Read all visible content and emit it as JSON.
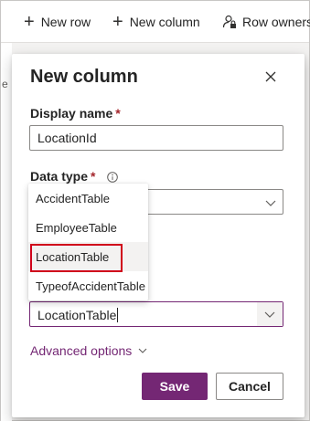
{
  "command_bar": {
    "new_row": "New row",
    "new_column": "New column",
    "row_ownership": "Row ownershi"
  },
  "left_strip": {
    "glyph": "e"
  },
  "panel": {
    "title": "New column",
    "display_name": {
      "label": "Display name",
      "required_mark": "*",
      "value": "LocationId"
    },
    "data_type": {
      "label": "Data type",
      "required_mark": "*"
    },
    "lookup": {
      "value": "LocationTable"
    },
    "advanced_options": "Advanced options",
    "save_label": "Save",
    "cancel_label": "Cancel"
  },
  "dropdown_menu": {
    "items": [
      {
        "label": "AccidentTable"
      },
      {
        "label": "EmployeeTable"
      },
      {
        "label": "LocationTable"
      },
      {
        "label": "TypeofAccidentTable"
      }
    ],
    "selected": "LocationTable"
  },
  "colors": {
    "accent": "#742774",
    "required": "#a4262c",
    "highlight": "#d0021b"
  }
}
